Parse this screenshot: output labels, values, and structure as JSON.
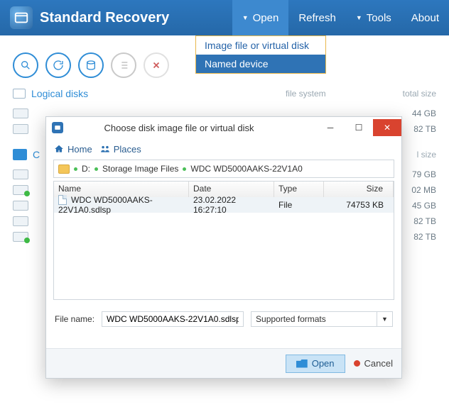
{
  "app": {
    "title": "Standard Recovery"
  },
  "menu": {
    "open": "Open",
    "refresh": "Refresh",
    "tools": "Tools",
    "about": "About"
  },
  "dropdown": {
    "image": "Image file or virtual disk",
    "named": "Named device"
  },
  "sections": {
    "logical": "Logical disks",
    "connected_initial": "C",
    "fs_label": "file system",
    "size_label": "total size",
    "size_label2": "l size"
  },
  "sizes": [
    "44 GB",
    "82 TB",
    "79 GB",
    "02 MB",
    "45 GB",
    "82 TB",
    "82 TB"
  ],
  "dialog": {
    "title": "Choose disk image file or virtual disk",
    "home": "Home",
    "places": "Places",
    "breadcrumb": {
      "drive": "D:",
      "folder": "Storage Image Files",
      "leaf": "WDC WD5000AAKS-22V1A0"
    },
    "cols": {
      "name": "Name",
      "date": "Date",
      "type": "Type",
      "size": "Size"
    },
    "row": {
      "name": "WDC WD5000AAKS-22V1A0.sdlsp",
      "date": "23.02.2022 16:27:10",
      "type": "File",
      "size": "74753 KB"
    },
    "fname_label": "File name:",
    "fname_value": "WDC WD5000AAKS-22V1A0.sdlsp",
    "format": "Supported formats",
    "open_btn": "Open",
    "cancel_btn": "Cancel"
  }
}
